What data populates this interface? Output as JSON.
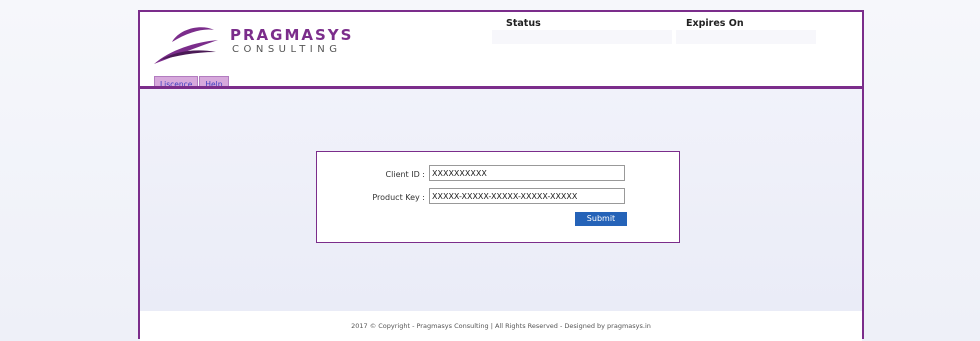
{
  "header": {
    "brand_name": "PRAGMASYS",
    "brand_sub": "CONSULTING",
    "col_status": "Status",
    "col_expires": "Expires On"
  },
  "tabs": [
    {
      "label": "Liscence"
    },
    {
      "label": "Help"
    }
  ],
  "form": {
    "client_id_label": "Client ID :",
    "client_id_value": "XXXXXXXXXX",
    "product_key_label": "Product Key :",
    "product_key_value": "XXXXX-XXXXX-XXXXX-XXXXX-XXXXX",
    "submit_label": "Submit"
  },
  "footer": {
    "text": "2017 © Copyright - Pragmasys Consulting | All Rights Reserved - Designed by pragmasys.in"
  },
  "colors": {
    "brand": "#7b2d8b",
    "button": "#2563b8",
    "tab": "#d7a9dc"
  },
  "icons": {
    "logo": "swoosh-logo-icon"
  }
}
